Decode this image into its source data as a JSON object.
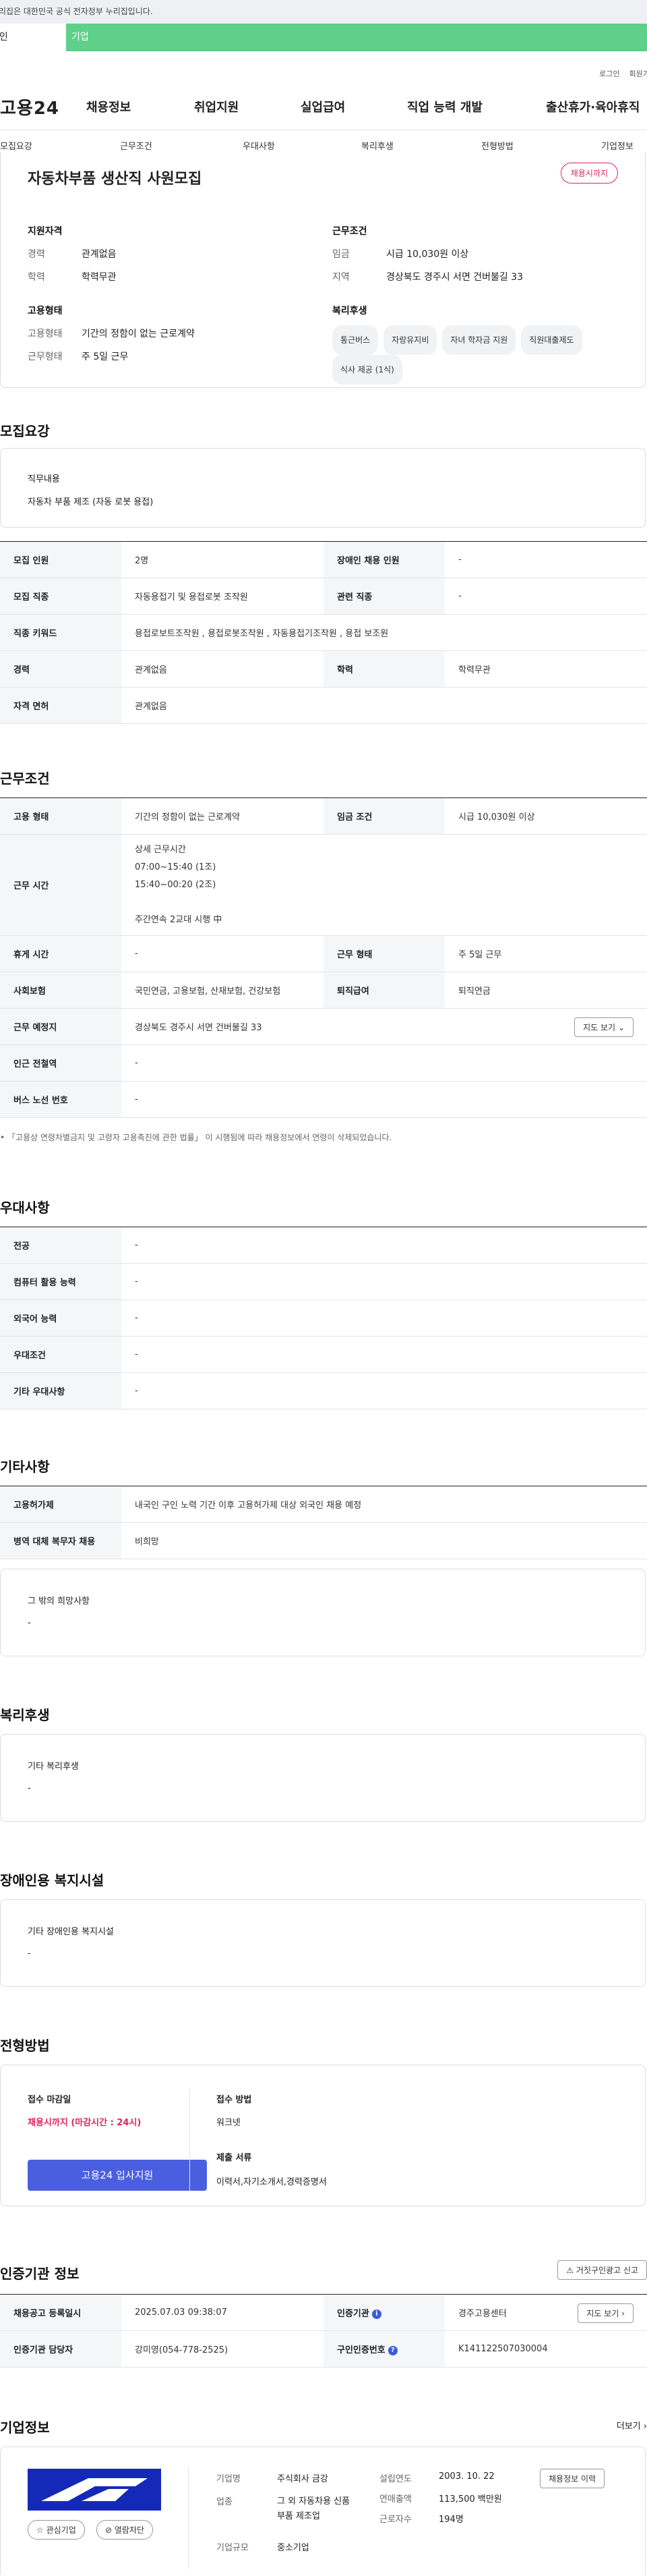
{
  "gov_banner": "이 누리집은 대한민국 공식 전자정부 누리집입니다.",
  "top_tabs": {
    "personal": "개인",
    "enterprise": "기업"
  },
  "util": {
    "login": "로그인",
    "join": "회원가입"
  },
  "logo": "고용24",
  "gnb": [
    "채용정보",
    "취업지원",
    "실업급여",
    "직업 능력 개발",
    "출산휴가·육아휴직"
  ],
  "subnav": [
    "모집요강",
    "근무조건",
    "우대사항",
    "복리후생",
    "전형방법",
    "기업정보"
  ],
  "summary": {
    "title": "자동차부품 생산직 사원모집",
    "status": "채용시까지",
    "qual_title": "지원자격",
    "career_label": "경력",
    "career_value": "관계없음",
    "edu_label": "학력",
    "edu_value": "학력무관",
    "emp_title": "고용형태",
    "emp_label": "고용형태",
    "emp_value": "기간의 정함이 없는 근로계약",
    "work_label": "근무형태",
    "work_value": "주 5일 근무",
    "cond_title": "근무조건",
    "wage_label": "임금",
    "wage_value": "시급 10,030원 이상",
    "area_label": "지역",
    "area_value": "경상북도 경주시 서면 건버불길 33",
    "welfare_title": "복리후생",
    "chips": [
      "통근버스",
      "자랑유지비",
      "자녀 학자금 지원",
      "직원대출제도",
      "식사 제공 (1식)"
    ]
  },
  "recruit": {
    "section_title": "모집요강",
    "duty_label": "직무내용",
    "duty_value": "자동차 부품 제조 (자동 로봇 용접)",
    "rows": [
      {
        "k1": "모집 인원",
        "v1": "2명",
        "k2": "장애인 채용 인원",
        "v2": "-"
      },
      {
        "k1": "모집 직종",
        "v1": "자동용접기 및 용접로봇 조작원",
        "k2": "관련 직종",
        "v2": "-"
      },
      {
        "k1": "직종 키워드",
        "v1": "용접로보트조작원 , 용접로봇조작원 , 자동용접기조작원 , 용접 보조원"
      },
      {
        "k1": "경력",
        "v1": "관계없음",
        "k2": "학력",
        "v2": "학력무관"
      },
      {
        "k1": "자격 면허",
        "v1": "관계없음"
      }
    ]
  },
  "work": {
    "section_title": "근무조건",
    "emp_k": "고용 형태",
    "emp_v": "기간의 정함이 없는 근로계약",
    "wage_k": "임금 조건",
    "wage_v": "시급 10,030원 이상",
    "time_k": "근무 시간",
    "time_lines": [
      "상세 근무시간",
      "07:00~15:40 (1조)",
      "15:40~00:20 (2조)",
      "",
      "주간연속 2교대 시행 中"
    ],
    "rest_k": "휴게 시간",
    "rest_v": "-",
    "form_k": "근무 형태",
    "form_v": "주 5일 근무",
    "ins_k": "사회보험",
    "ins_v": "국민연금, 고용보험, 산재보험, 건강보험",
    "sev_k": "퇴직급여",
    "sev_v": "퇴직연금",
    "place_k": "근무 예정지",
    "place_v": "경상북도 경주시 서면 건버불길 33",
    "map_btn": "지도 보기",
    "subway_k": "인근 전철역",
    "subway_v": "-",
    "bus_k": "버스 노선 번호",
    "bus_v": "-",
    "note": "「고용상 연령차별금지 및 고령자 고용촉진에 관한 법률」 이 시행됨에 따라 채용정보에서 연령이 삭제되었습니다."
  },
  "pref": {
    "section_title": "우대사항",
    "rows": [
      {
        "k": "전공",
        "v": "-"
      },
      {
        "k": "컴퓨터 활용 능력",
        "v": "-"
      },
      {
        "k": "외국어 능력",
        "v": "-"
      },
      {
        "k": "우대조건",
        "v": "-"
      },
      {
        "k": "기타 우대사항",
        "v": "-"
      }
    ]
  },
  "etc": {
    "section_title": "기타사항",
    "rows": [
      {
        "k": "고용허가제",
        "v": "내국인 구인 노력 기간 이후 고용허가제 대상 외국인 채용 예정"
      },
      {
        "k": "병역 대체 복무자 채용",
        "v": "비희망"
      }
    ],
    "other_label": "그 밖의 희망사항",
    "other_value": "-"
  },
  "welfare": {
    "section_title": "복리후생",
    "label": "기타 복리후생",
    "value": "-"
  },
  "disabled": {
    "section_title": "장애인용 복지시설",
    "label": "기타 장애인용 복지시설",
    "value": "-"
  },
  "selection": {
    "section_title": "전형방법",
    "deadline_label": "접수 마감일",
    "deadline_value": "채용시까지 (마감시간 : 24시)",
    "apply_btn": "고용24 입사지원",
    "method_label": "접수 방법",
    "method_value": "워크넷",
    "docs_label": "제출 서류",
    "docs_value": "이력서,자기소개서,경력증명서"
  },
  "cert": {
    "section_title": "인증기관 정보",
    "report_btn": "거짓구인광고 신고",
    "reg_k": "채용공고 등록일시",
    "reg_v": "2025.07.03 09:38:07",
    "org_k": "인증기관",
    "org_v": "경주고용센터",
    "map_btn": "지도 보기",
    "mgr_k": "인증기관 담당자",
    "mgr_v": "강미영(054-778-2525)",
    "num_k": "구인인증번호",
    "num_v": "K141122507030004"
  },
  "company": {
    "section_title": "기업정보",
    "more": "더보기",
    "fav_btn": "관심기업",
    "block_btn": "열람차단",
    "name_k": "기업명",
    "name_v": "주식회사 금강",
    "ind_k": "업종",
    "ind_v": "그 외 자동차용 신품 부품 제조업",
    "size_k": "기업규모",
    "size_v": "중소기업",
    "est_k": "설립연도",
    "est_v": "2003. 10. 22",
    "rev_k": "연매출액",
    "rev_v": "113,500 백만원",
    "emp_k": "근로자수",
    "emp_v": "194명",
    "history_btn": "채용정보 이력"
  },
  "colors": {
    "accent_green": "#5fd08a",
    "accent_red": "#e0245e",
    "accent_blue": "#4a5fe0"
  }
}
